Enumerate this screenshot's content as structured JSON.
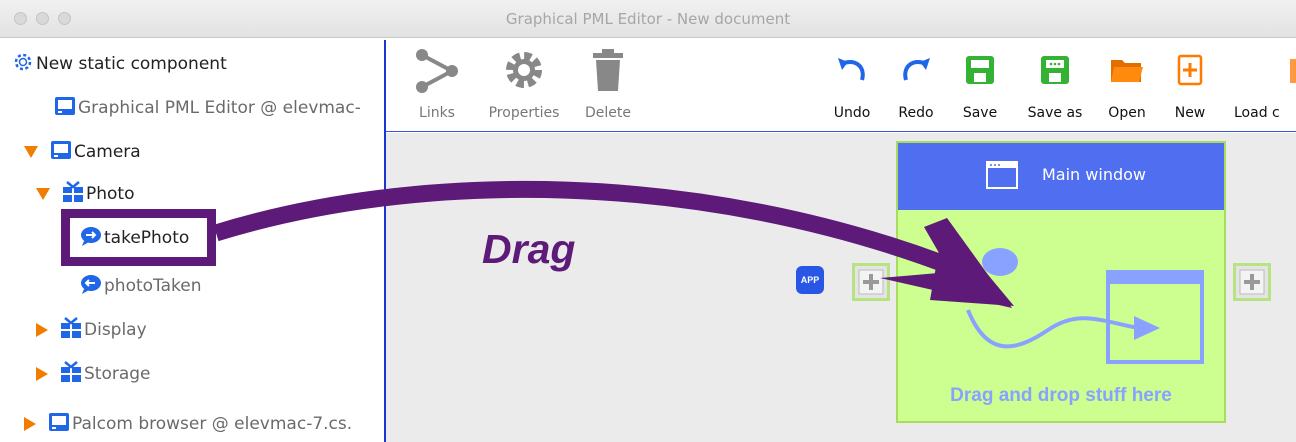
{
  "window": {
    "title": "Graphical PML Editor - New document"
  },
  "tree": {
    "root": "New static component",
    "items": [
      {
        "label": "Graphical PML Editor @ elevmac-"
      },
      {
        "label": "Camera"
      },
      {
        "label": "Photo"
      },
      {
        "label": "takePhoto"
      },
      {
        "label": "photoTaken"
      },
      {
        "label": "Display"
      },
      {
        "label": "Storage"
      },
      {
        "label": "Palcom browser @ elevmac-7.cs."
      }
    ]
  },
  "toolbar": {
    "links": "Links",
    "properties": "Properties",
    "delete": "Delete",
    "undo": "Undo",
    "redo": "Redo",
    "save": "Save",
    "save_as": "Save as",
    "open": "Open",
    "new": "New",
    "load": "Load c"
  },
  "canvas": {
    "main_window_title": "Main window",
    "drop_hint": "Drag and drop stuff here",
    "app_badge": "APP"
  },
  "annotation": {
    "drag": "Drag"
  },
  "colors": {
    "accent_blue": "#4f6ef0",
    "drop_area": "#ccff8f",
    "annotation_purple": "#5d1a78",
    "tree_arrow": "#f07d00"
  }
}
